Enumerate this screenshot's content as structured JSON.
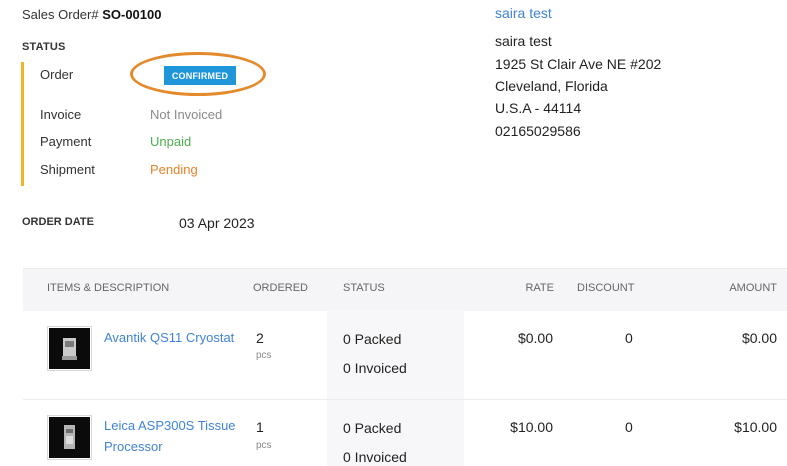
{
  "header": {
    "sales_order_label": "Sales Order#",
    "sales_order_number": "SO-00100"
  },
  "status": {
    "heading": "STATUS",
    "rows": [
      {
        "key": "Order",
        "value": "CONFIRMED"
      },
      {
        "key": "Invoice",
        "value": "Not Invoiced"
      },
      {
        "key": "Payment",
        "value": "Unpaid"
      },
      {
        "key": "Shipment",
        "value": "Pending"
      }
    ]
  },
  "customer": {
    "name_link": "saira test",
    "name": "saira test",
    "address_line1": "1925 St Clair Ave NE #202",
    "address_line2": "Cleveland, Florida",
    "address_line3": "U.S.A - 44114",
    "phone": "02165029586"
  },
  "order_date": {
    "label": "ORDER DATE",
    "value": "03 Apr 2023"
  },
  "table": {
    "headers": [
      "ITEMS & DESCRIPTION",
      "ORDERED",
      "STATUS",
      "RATE",
      "DISCOUNT",
      "AMOUNT"
    ],
    "rows": [
      {
        "name": "Avantik QS11 Cryostat",
        "qty": "2",
        "unit": "pcs",
        "packed": "0  Packed",
        "invoiced": "0  Invoiced",
        "rate": "$0.00",
        "discount": "0",
        "amount": "$0.00"
      },
      {
        "name_line1": "Leica ASP300S Tissue",
        "name_line2": "Processor",
        "qty": "1",
        "unit": "pcs",
        "packed": "0  Packed",
        "invoiced": "0  Invoiced",
        "rate": "$10.00",
        "discount": "0",
        "amount": "$10.00"
      }
    ]
  },
  "colors": {
    "accent_blue": "#1f96d9",
    "link_blue": "#3f84d6",
    "status_bar": "#f0b429",
    "highlight": "#e58a2c",
    "green": "#4caf50",
    "orange": "#e6822a"
  }
}
